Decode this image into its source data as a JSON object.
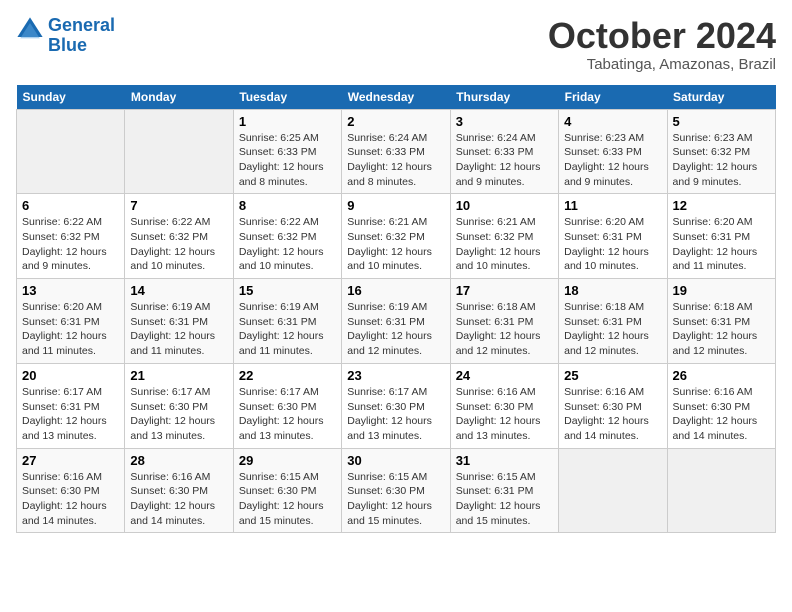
{
  "header": {
    "logo_line1": "General",
    "logo_line2": "Blue",
    "month": "October 2024",
    "location": "Tabatinga, Amazonas, Brazil"
  },
  "weekdays": [
    "Sunday",
    "Monday",
    "Tuesday",
    "Wednesday",
    "Thursday",
    "Friday",
    "Saturday"
  ],
  "weeks": [
    [
      {
        "day": "",
        "info": ""
      },
      {
        "day": "",
        "info": ""
      },
      {
        "day": "1",
        "info": "Sunrise: 6:25 AM\nSunset: 6:33 PM\nDaylight: 12 hours\nand 8 minutes."
      },
      {
        "day": "2",
        "info": "Sunrise: 6:24 AM\nSunset: 6:33 PM\nDaylight: 12 hours\nand 8 minutes."
      },
      {
        "day": "3",
        "info": "Sunrise: 6:24 AM\nSunset: 6:33 PM\nDaylight: 12 hours\nand 9 minutes."
      },
      {
        "day": "4",
        "info": "Sunrise: 6:23 AM\nSunset: 6:33 PM\nDaylight: 12 hours\nand 9 minutes."
      },
      {
        "day": "5",
        "info": "Sunrise: 6:23 AM\nSunset: 6:32 PM\nDaylight: 12 hours\nand 9 minutes."
      }
    ],
    [
      {
        "day": "6",
        "info": "Sunrise: 6:22 AM\nSunset: 6:32 PM\nDaylight: 12 hours\nand 9 minutes."
      },
      {
        "day": "7",
        "info": "Sunrise: 6:22 AM\nSunset: 6:32 PM\nDaylight: 12 hours\nand 10 minutes."
      },
      {
        "day": "8",
        "info": "Sunrise: 6:22 AM\nSunset: 6:32 PM\nDaylight: 12 hours\nand 10 minutes."
      },
      {
        "day": "9",
        "info": "Sunrise: 6:21 AM\nSunset: 6:32 PM\nDaylight: 12 hours\nand 10 minutes."
      },
      {
        "day": "10",
        "info": "Sunrise: 6:21 AM\nSunset: 6:32 PM\nDaylight: 12 hours\nand 10 minutes."
      },
      {
        "day": "11",
        "info": "Sunrise: 6:20 AM\nSunset: 6:31 PM\nDaylight: 12 hours\nand 10 minutes."
      },
      {
        "day": "12",
        "info": "Sunrise: 6:20 AM\nSunset: 6:31 PM\nDaylight: 12 hours\nand 11 minutes."
      }
    ],
    [
      {
        "day": "13",
        "info": "Sunrise: 6:20 AM\nSunset: 6:31 PM\nDaylight: 12 hours\nand 11 minutes."
      },
      {
        "day": "14",
        "info": "Sunrise: 6:19 AM\nSunset: 6:31 PM\nDaylight: 12 hours\nand 11 minutes."
      },
      {
        "day": "15",
        "info": "Sunrise: 6:19 AM\nSunset: 6:31 PM\nDaylight: 12 hours\nand 11 minutes."
      },
      {
        "day": "16",
        "info": "Sunrise: 6:19 AM\nSunset: 6:31 PM\nDaylight: 12 hours\nand 12 minutes."
      },
      {
        "day": "17",
        "info": "Sunrise: 6:18 AM\nSunset: 6:31 PM\nDaylight: 12 hours\nand 12 minutes."
      },
      {
        "day": "18",
        "info": "Sunrise: 6:18 AM\nSunset: 6:31 PM\nDaylight: 12 hours\nand 12 minutes."
      },
      {
        "day": "19",
        "info": "Sunrise: 6:18 AM\nSunset: 6:31 PM\nDaylight: 12 hours\nand 12 minutes."
      }
    ],
    [
      {
        "day": "20",
        "info": "Sunrise: 6:17 AM\nSunset: 6:31 PM\nDaylight: 12 hours\nand 13 minutes."
      },
      {
        "day": "21",
        "info": "Sunrise: 6:17 AM\nSunset: 6:30 PM\nDaylight: 12 hours\nand 13 minutes."
      },
      {
        "day": "22",
        "info": "Sunrise: 6:17 AM\nSunset: 6:30 PM\nDaylight: 12 hours\nand 13 minutes."
      },
      {
        "day": "23",
        "info": "Sunrise: 6:17 AM\nSunset: 6:30 PM\nDaylight: 12 hours\nand 13 minutes."
      },
      {
        "day": "24",
        "info": "Sunrise: 6:16 AM\nSunset: 6:30 PM\nDaylight: 12 hours\nand 13 minutes."
      },
      {
        "day": "25",
        "info": "Sunrise: 6:16 AM\nSunset: 6:30 PM\nDaylight: 12 hours\nand 14 minutes."
      },
      {
        "day": "26",
        "info": "Sunrise: 6:16 AM\nSunset: 6:30 PM\nDaylight: 12 hours\nand 14 minutes."
      }
    ],
    [
      {
        "day": "27",
        "info": "Sunrise: 6:16 AM\nSunset: 6:30 PM\nDaylight: 12 hours\nand 14 minutes."
      },
      {
        "day": "28",
        "info": "Sunrise: 6:16 AM\nSunset: 6:30 PM\nDaylight: 12 hours\nand 14 minutes."
      },
      {
        "day": "29",
        "info": "Sunrise: 6:15 AM\nSunset: 6:30 PM\nDaylight: 12 hours\nand 15 minutes."
      },
      {
        "day": "30",
        "info": "Sunrise: 6:15 AM\nSunset: 6:30 PM\nDaylight: 12 hours\nand 15 minutes."
      },
      {
        "day": "31",
        "info": "Sunrise: 6:15 AM\nSunset: 6:31 PM\nDaylight: 12 hours\nand 15 minutes."
      },
      {
        "day": "",
        "info": ""
      },
      {
        "day": "",
        "info": ""
      }
    ]
  ]
}
